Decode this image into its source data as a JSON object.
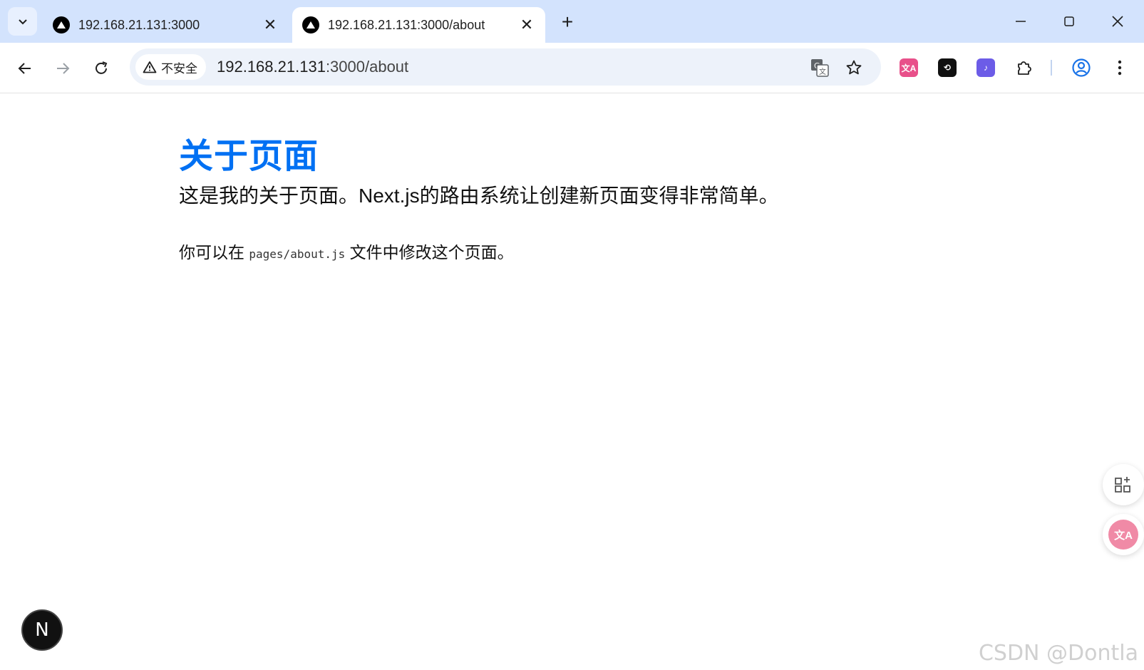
{
  "window": {
    "tabs": [
      {
        "title": "192.168.21.131:3000",
        "active": false
      },
      {
        "title": "192.168.21.131:3000/about",
        "active": true
      }
    ],
    "controls": {
      "minimize": "minimize-icon",
      "maximize": "maximize-icon",
      "close": "close-icon"
    }
  },
  "toolbar": {
    "security_label": "不安全",
    "url_host": "192.168.21.131",
    "url_path": ":3000/about",
    "extensions": [
      {
        "name": "translate-extension",
        "color": "#e8508a",
        "glyph": "文A"
      },
      {
        "name": "chatgpt-extension",
        "color": "#111111",
        "glyph": "⟲"
      },
      {
        "name": "audio-extension",
        "color": "#6c5ce7",
        "glyph": "♪"
      }
    ]
  },
  "page": {
    "title": "关于页面",
    "intro": "这是我的关于页面。Next.js的路由系统让创建新页面变得非常简单。",
    "note_before": "你可以在 ",
    "note_code": "pages/about.js",
    "note_after": " 文件中修改这个页面。"
  },
  "next_badge": "N",
  "watermark": "CSDN @Dontla",
  "colors": {
    "title": "#0070f3",
    "tabstrip": "#d3e3fd",
    "omnibox": "#edf2fa"
  }
}
